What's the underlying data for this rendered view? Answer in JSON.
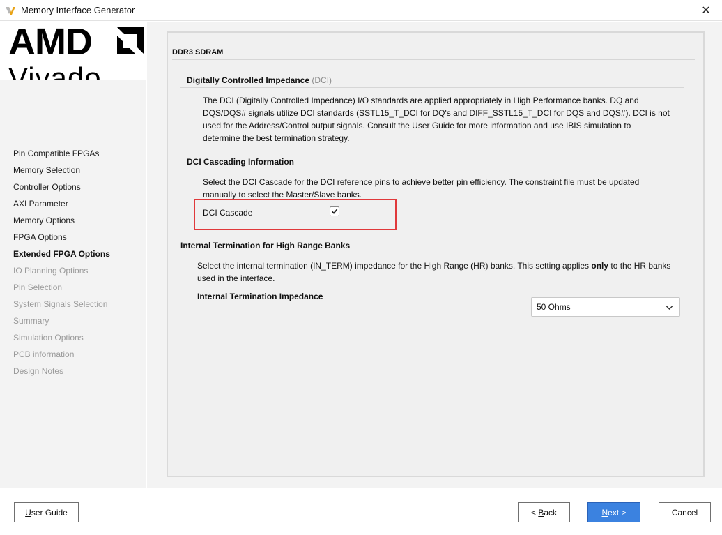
{
  "window": {
    "title": "Memory Interface Generator",
    "app_icon": "vivado-icon",
    "close_glyph": "✕"
  },
  "logo": {
    "brand": "AMD",
    "product": "Vivado"
  },
  "nav": {
    "items": [
      {
        "label": "Pin Compatible FPGAs",
        "state": "normal"
      },
      {
        "label": "Memory Selection",
        "state": "normal"
      },
      {
        "label": "Controller Options",
        "state": "normal"
      },
      {
        "label": "AXI Parameter",
        "state": "normal"
      },
      {
        "label": "Memory Options",
        "state": "normal"
      },
      {
        "label": "FPGA Options",
        "state": "normal"
      },
      {
        "label": "Extended FPGA Options",
        "state": "active"
      },
      {
        "label": "IO Planning Options",
        "state": "disabled"
      },
      {
        "label": "Pin Selection",
        "state": "disabled"
      },
      {
        "label": "System Signals Selection",
        "state": "disabled"
      },
      {
        "label": "Summary",
        "state": "disabled"
      },
      {
        "label": "Simulation Options",
        "state": "disabled"
      },
      {
        "label": "PCB information",
        "state": "disabled"
      },
      {
        "label": "Design Notes",
        "state": "disabled"
      }
    ]
  },
  "main": {
    "section_title": "DDR3 SDRAM",
    "dci": {
      "heading": "Digitally Controlled Impedance",
      "heading_suffix": "(DCI)",
      "description": "The DCI (Digitally Controlled Impedance) I/O standards are applied appropriately in High Performance banks. DQ and DQS/DQS# signals utilize DCI standards (SSTL15_T_DCI for DQ's and DIFF_SSTL15_T_DCI for DQS and DQS#). DCI is not used for the Address/Control output signals. Consult the User Guide for more information and use IBIS simulation to determine the best termination strategy."
    },
    "dci_cascading": {
      "heading": "DCI Cascading Information",
      "description": "Select the DCI Cascade for the DCI reference pins to achieve better pin efficiency. The constraint file must be updated manually to select the Master/Slave banks.",
      "checkbox_label": "DCI Cascade",
      "checked": true
    },
    "internal_termination": {
      "heading": "Internal Termination for High Range Banks",
      "desc_before": "Select the internal termination (IN_TERM) impedance for the High Range (HR) banks. This setting applies ",
      "desc_bold": "only",
      "desc_after": " to the HR banks used in the interface.",
      "field_label": "Internal Termination Impedance",
      "selected_value": "50 Ohms"
    }
  },
  "buttons": {
    "user_guide": {
      "mnemonic": "U",
      "rest": "ser Guide"
    },
    "back": {
      "prefix": "< ",
      "mnemonic": "B",
      "rest": "ack"
    },
    "next": {
      "mnemonic": "N",
      "rest": "ext >"
    },
    "cancel": "Cancel"
  },
  "colors": {
    "highlight": "#e0393b",
    "primary_button": "#3b82e0"
  }
}
